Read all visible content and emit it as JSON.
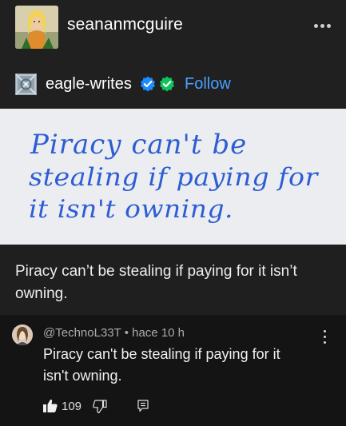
{
  "header": {
    "username": "seananmcguire",
    "avatar_icon": "illustrated-avatar-icon",
    "more_icon": "more-options-icon"
  },
  "reblog": {
    "username": "eagle-writes",
    "avatar_icon": "pattern-avatar-icon",
    "badges": [
      "blue-check-badge-icon",
      "green-check-badge-icon"
    ],
    "follow_label": "Follow",
    "colors": {
      "follow": "#4aa0ff",
      "badge_blue": "#1d8cff",
      "badge_green": "#10c45b"
    }
  },
  "artwork": {
    "lines": [
      "Piracy can't be",
      "stealing if paying for",
      "it isn't owning."
    ],
    "colors": {
      "ink": "#2d5dd4",
      "paper": "#ecedf0"
    }
  },
  "post": {
    "text": "Piracy can’t be stealing if paying for it isn’t owning."
  },
  "youtube_comment": {
    "author": "@TechnoL33T",
    "separator": "•",
    "time": "hace 10 h",
    "meta_line": "@TechnoL33T • hace 10 h",
    "comment": "Piracy can't be stealing if paying for it isn't owning.",
    "likes": "109",
    "icons": [
      "thumbs-up-icon",
      "thumbs-down-icon",
      "reply-icon",
      "kebab-menu-icon"
    ]
  }
}
